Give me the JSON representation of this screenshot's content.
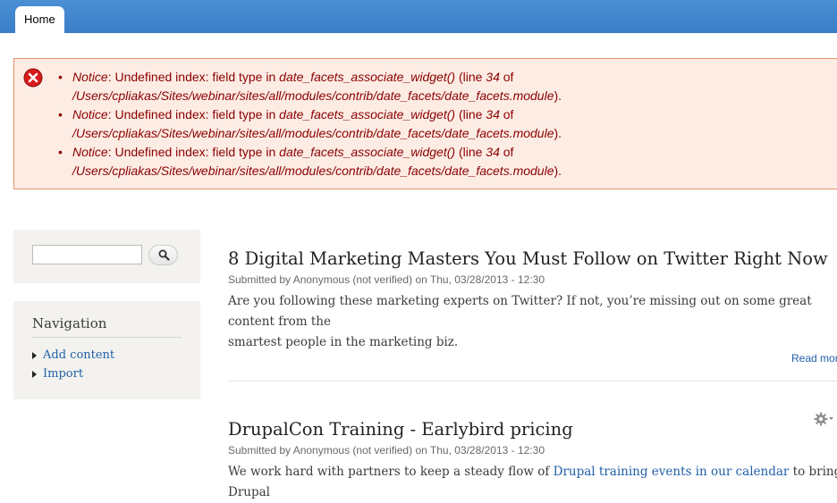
{
  "tabs": {
    "home": "Home"
  },
  "messages": {
    "items": [
      {
        "label": "Notice",
        "text1": ": Undefined index: field type in ",
        "func": "date_facets_associate_widget()",
        "text2": " (line ",
        "line": "34",
        "text3": " of",
        "path": "/Users/cpliakas/Sites/webinar/sites/all/modules/contrib/date_facets/date_facets.module",
        "end": ")."
      },
      {
        "label": "Notice",
        "text1": ": Undefined index: field type in ",
        "func": "date_facets_associate_widget()",
        "text2": " (line ",
        "line": "34",
        "text3": " of",
        "path": "/Users/cpliakas/Sites/webinar/sites/all/modules/contrib/date_facets/date_facets.module",
        "end": ")."
      },
      {
        "label": "Notice",
        "text1": ": Undefined index: field type in ",
        "func": "date_facets_associate_widget()",
        "text2": " (line ",
        "line": "34",
        "text3": " of",
        "path": "/Users/cpliakas/Sites/webinar/sites/all/modules/contrib/date_facets/date_facets.module",
        "end": ")."
      }
    ]
  },
  "search": {
    "value": ""
  },
  "navigation": {
    "title": "Navigation",
    "items": [
      "Add content",
      "Import"
    ]
  },
  "nodes": [
    {
      "title": "8 Digital Marketing Masters You Must Follow on Twitter Right Now",
      "meta": "Submitted by Anonymous (not verified) on Thu, 03/28/2013 - 12:30",
      "body_line1": "Are you following these marketing experts on Twitter? If not, you’re missing out on some great content from the",
      "body_line2": "smartest people in the marketing biz.",
      "read_more": "Read more"
    },
    {
      "title": "DrupalCon Training - Earlybird pricing",
      "meta": "Submitted by Anonymous (not verified) on Thu, 03/28/2013 - 12:30",
      "body_pre": "We work hard with partners to keep a steady flow of ",
      "body_link": "Drupal training events in our calendar",
      "body_post": " to bring Drupal"
    }
  ],
  "colors": {
    "topbar": "#3a7ec8",
    "link": "#2160a8",
    "error_text": "#8b0000",
    "error_bg": "#fdece4"
  }
}
